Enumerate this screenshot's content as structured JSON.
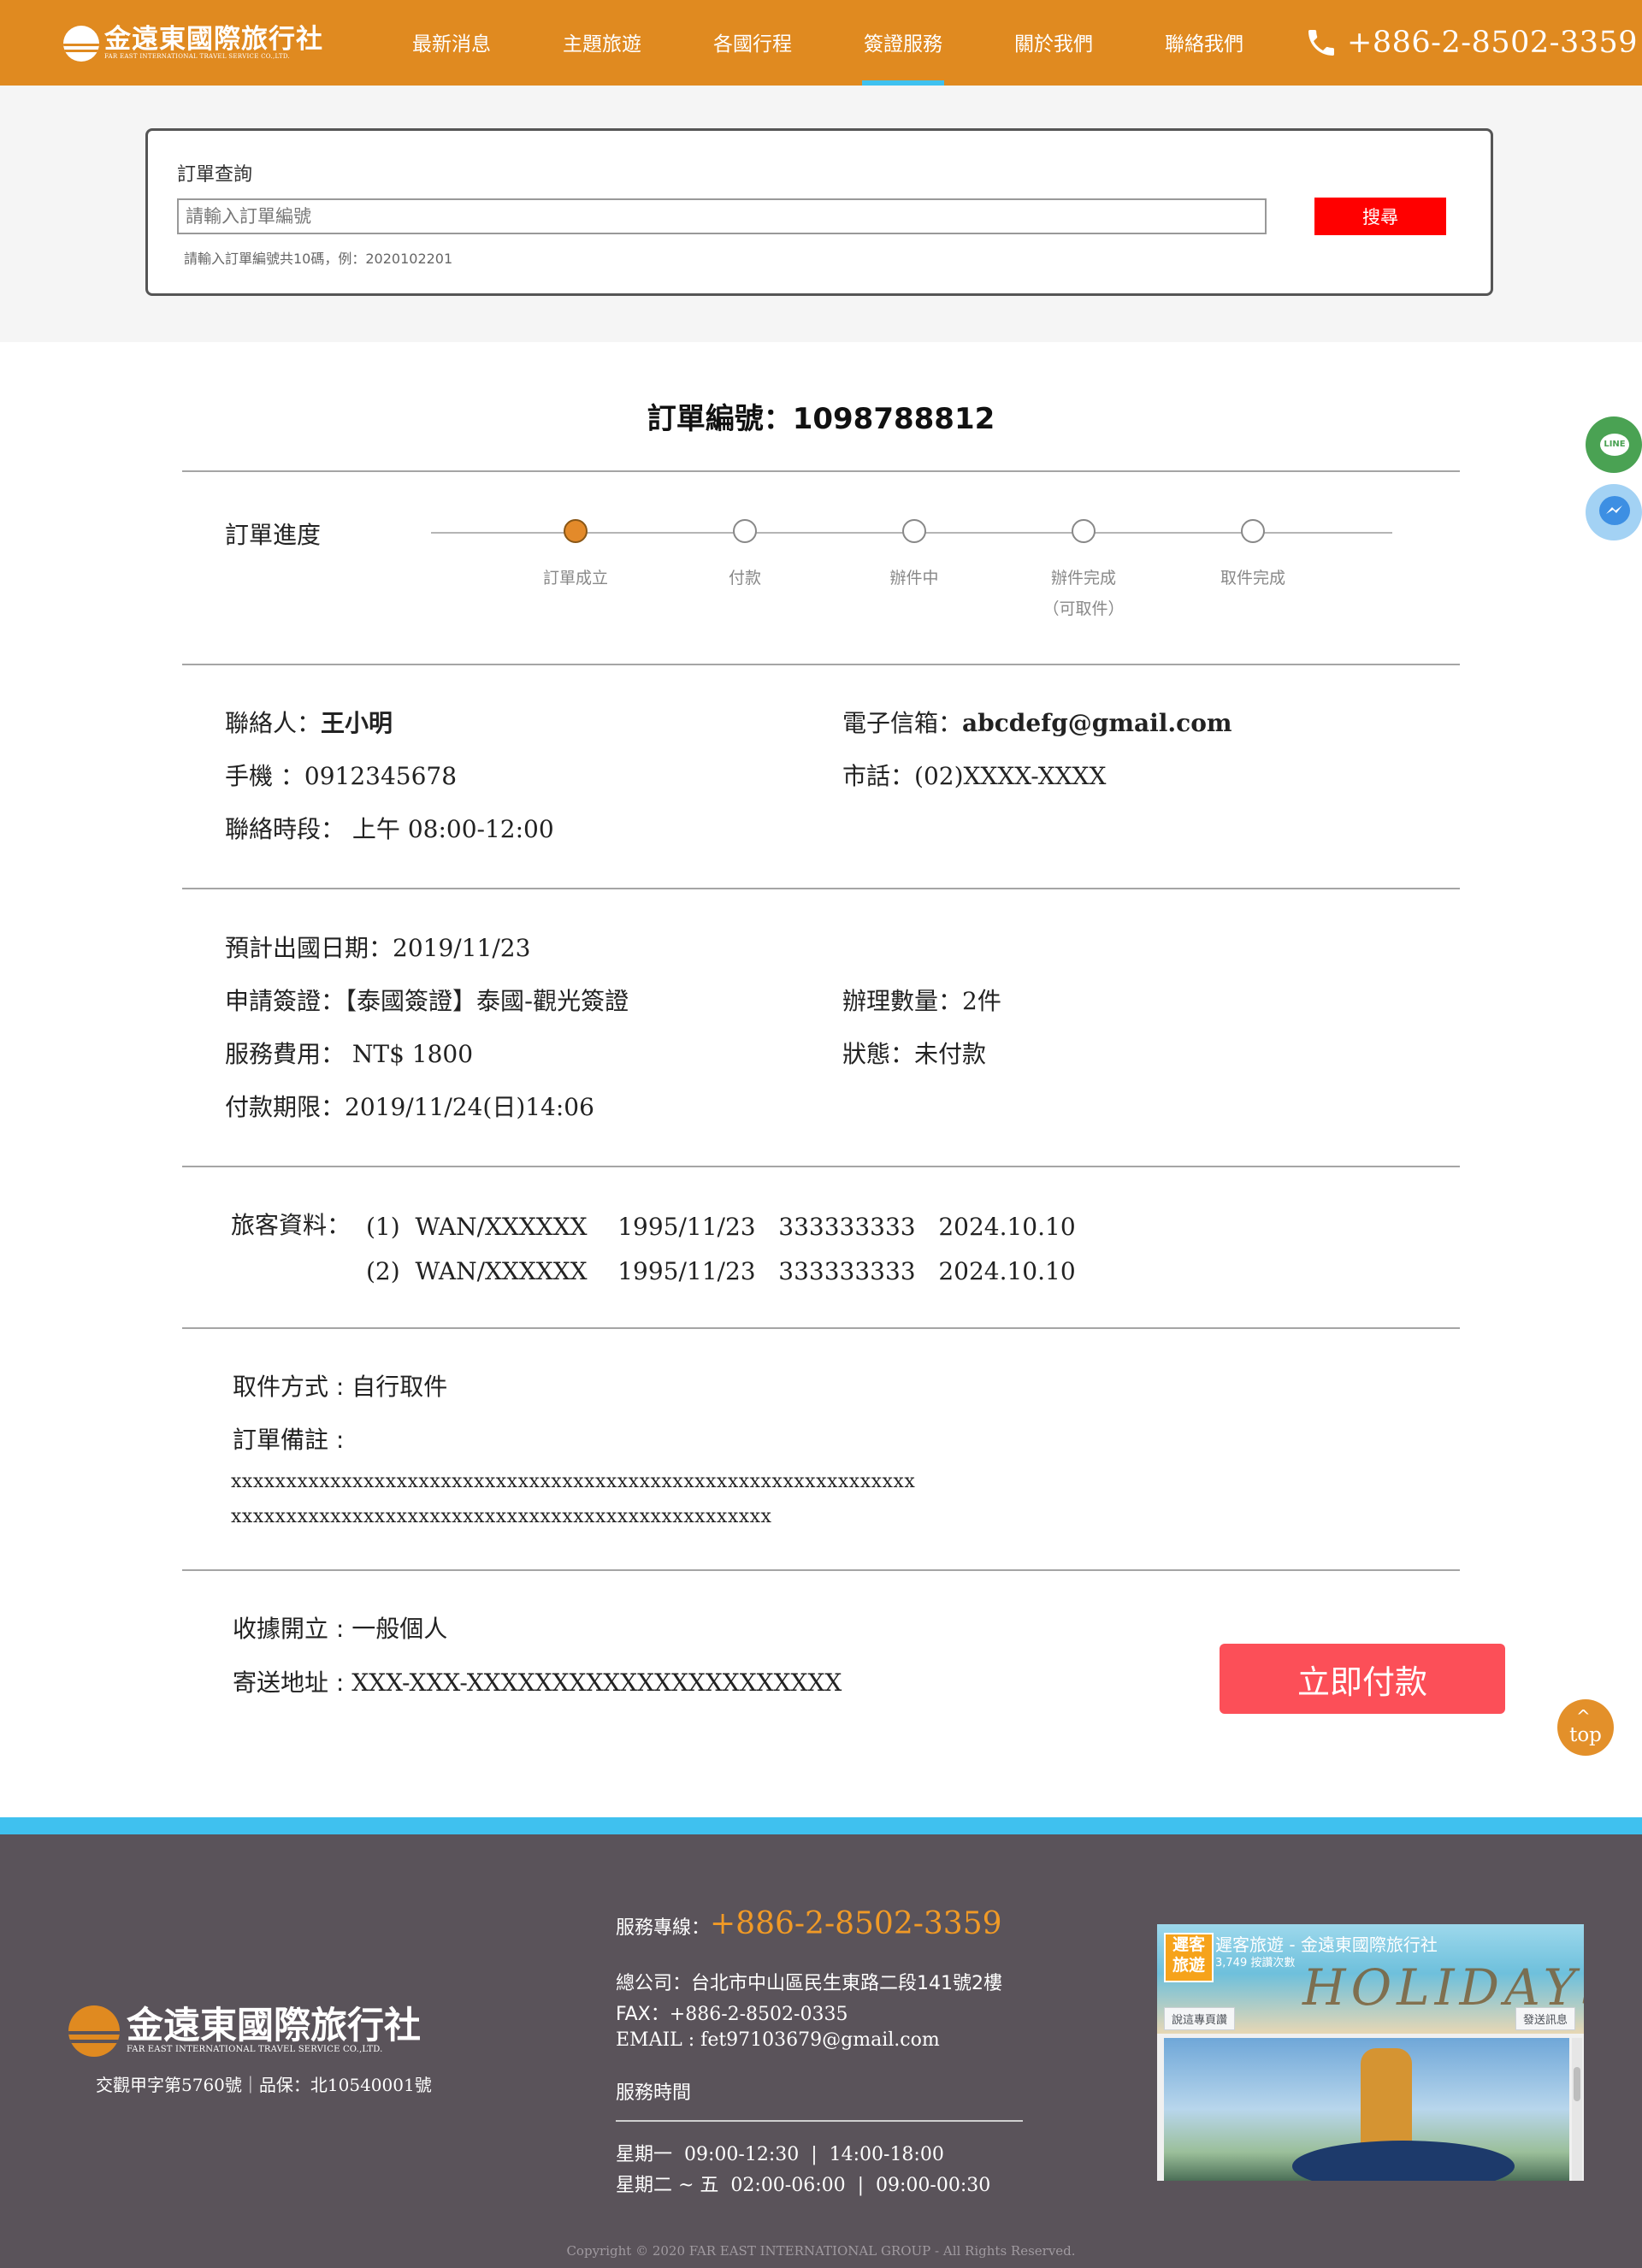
{
  "header": {
    "logo_title": "金遠東國際旅行社",
    "logo_subtitle": "FAR EAST INTERNATIONAL TRAVEL SERVICE CO.,LTD.",
    "nav": [
      "最新消息",
      "主題旅遊",
      "各國行程",
      "簽證服務",
      "關於我們",
      "聯絡我們"
    ],
    "active_nav": "簽證服務",
    "phone": "+886-2-8502-3359"
  },
  "search": {
    "label": "訂單查詢",
    "placeholder": "請輸入訂單編號",
    "hint": "請輸入訂單編號共10碼，例：2020102201",
    "button": "搜尋"
  },
  "order": {
    "title": "訂單編號：1098788812",
    "progress_label": "訂單進度",
    "steps": [
      {
        "label": "訂單成立",
        "sub": "",
        "active": true
      },
      {
        "label": "付款",
        "sub": "",
        "active": false
      },
      {
        "label": "辦件中",
        "sub": "",
        "active": false
      },
      {
        "label": "辦件完成",
        "sub": "（可取件）",
        "active": false
      },
      {
        "label": "取件完成",
        "sub": "",
        "active": false
      }
    ],
    "contact": {
      "name_label": "聯絡人：",
      "name": "王小明",
      "email_label": "電子信箱：",
      "email": "abcdefg@gmail.com",
      "mobile_label": "手機 ：",
      "mobile": "0912345678",
      "phone_label": "市話：",
      "phone": "(02)XXXX-XXXX",
      "time_label": "聯絡時段：",
      "time": " 上午 08:00-12:00"
    },
    "visa": {
      "depart_label": "預計出國日期：",
      "depart": "2019/11/23",
      "type_label": "申請簽證：",
      "type": "【泰國簽證】泰國-觀光簽證",
      "qty_label": "辦理數量：",
      "qty": "2件",
      "fee_label": "服務費用：",
      "fee": " NT$ 1800",
      "status_label": "狀態：",
      "status": "未付款",
      "deadline_label": "付款期限：",
      "deadline": "2019/11/24(日)14:06"
    },
    "travelers_label": "旅客資料：",
    "travelers": [
      "(1)  WAN/XXXXXX    1995/11/23   333333333   2024.10.10",
      "(2)  WAN/XXXXXX    1995/11/23   333333333   2024.10.10"
    ],
    "pickup_label": "取件方式 : ",
    "pickup": "自行取件",
    "note_label": "訂單備註 :",
    "note_lines": [
      "xxxxxxxxxxxxxxxxxxxxxxxxxxxxxxxxxxxxxxxxxxxxxxxxxxxxxxxxxxxxxx",
      "xxxxxxxxxxxxxxxxxxxxxxxxxxxxxxxxxxxxxxxxxxxxxxxxx"
    ],
    "receipt_label": "收據開立 : ",
    "receipt": "一般個人",
    "address_label": "寄送地址 : ",
    "address": "XXX-XXX-XXXXXXXXXXXXXXXXXXXXXX",
    "pay_button": "立即付款"
  },
  "floating": {
    "line_icon_text": "LINE",
    "top_label": "top"
  },
  "footer": {
    "logo_title": "金遠東國際旅行社",
    "logo_subtitle": "FAR EAST INTERNATIONAL TRAVEL SERVICE CO.,LTD.",
    "license": "交觀甲字第5760號｜品保：北10540001號",
    "hotline_label": "服務專線：",
    "hotline": "+886-2-8502-3359",
    "address_label": "總公司：",
    "address": "台北市中山區民生東路二段141號2樓",
    "fax_label": "FAX：",
    "fax": "+886-2-8502-0335",
    "email_label": "EMAIL : ",
    "email": "fet97103679@gmail.com",
    "hours_label": "服務時間",
    "hours": [
      "星期一  09:00-12:30  |  14:00-18:00",
      "星期二 ~ 五  02:00-06:00  |  09:00-00:30"
    ],
    "copyright": "Copyright © 2020 FAR EAST INTERNATIONAL GROUP - All Rights Reserved.",
    "fb": {
      "avatar_text": "遲客旅遊",
      "page_name": "遲客旅遊 - 金遠東國際旅行社",
      "likes": "3,749 按讚次數",
      "cover_text": "HOLIDAYS",
      "like_button": "說這專頁讚",
      "share_button": "發送訊息"
    }
  }
}
